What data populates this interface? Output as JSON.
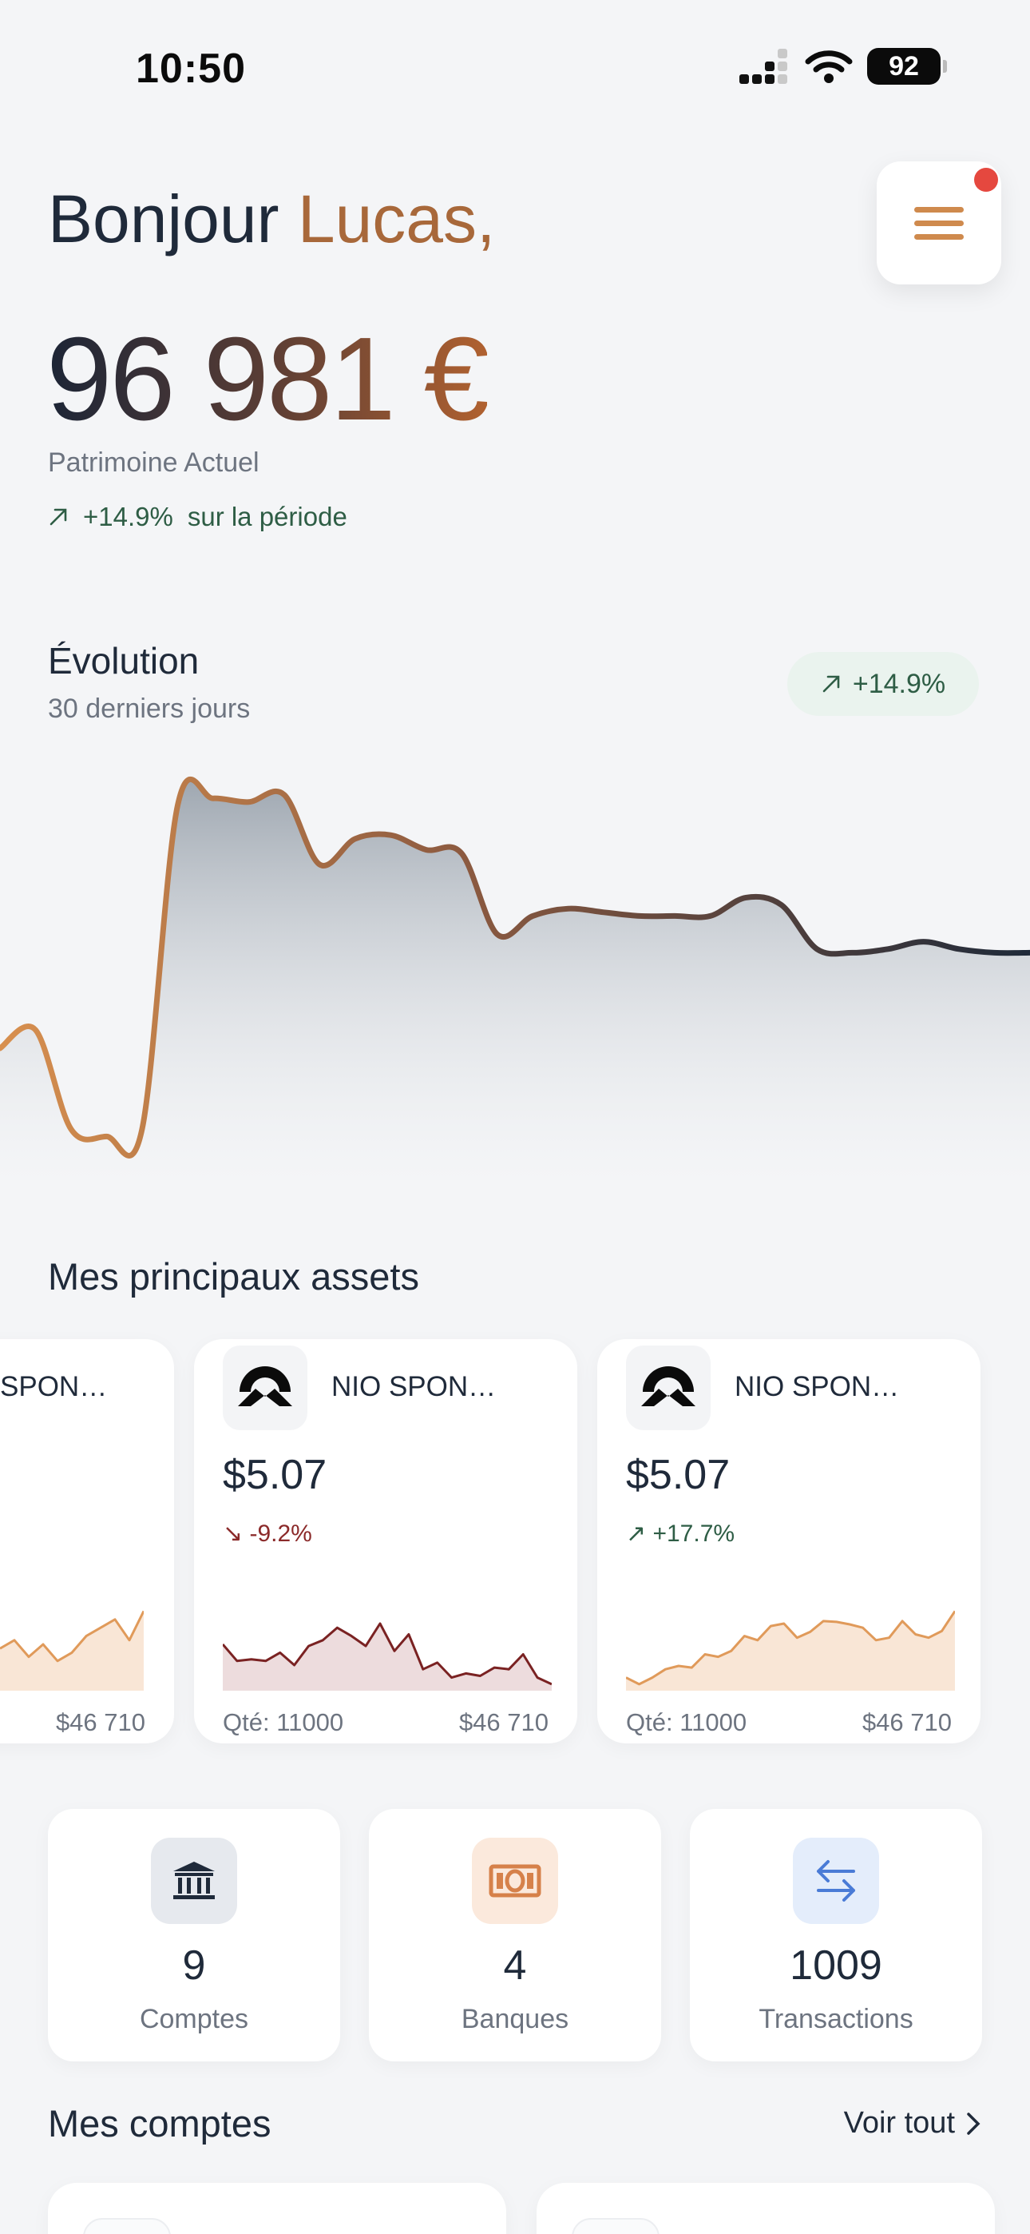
{
  "status": {
    "time": "10:50",
    "battery": "92"
  },
  "header": {
    "greeting": "Bonjour",
    "name": "Lucas,",
    "menu_has_notification": true
  },
  "balance": {
    "amount": "96 981 €",
    "label": "Patrimoine Actuel",
    "change": "+14.9%",
    "change_suffix": "sur la période"
  },
  "evolution": {
    "title": "Évolution",
    "subtitle": "30 derniers jours",
    "badge": "+14.9%"
  },
  "chart_data": {
    "type": "area",
    "title": "Évolution",
    "subtitle": "30 derniers jours",
    "xlabel": "",
    "ylabel": "",
    "series": [
      {
        "values": [
          0.3,
          0.35,
          0.08,
          0.06,
          0.08,
          0.96,
          0.98,
          0.97,
          0.99,
          0.8,
          0.87,
          0.88,
          0.84,
          0.83,
          0.61,
          0.66,
          0.68,
          0.67,
          0.66,
          0.66,
          0.66,
          0.71,
          0.69,
          0.57,
          0.56,
          0.57,
          0.59,
          0.57,
          0.56,
          0.56
        ]
      }
    ],
    "grid": false,
    "colors": [
      "#d18b4f",
      "#1f2a3a"
    ]
  },
  "assets": {
    "title": "Mes principaux assets",
    "cards": [
      {
        "name": "SPON…",
        "price": "",
        "change": "",
        "qty": "",
        "value": "$46 710",
        "trend": "up",
        "spark": [
          0.45,
          0.55,
          0.35,
          0.5,
          0.3,
          0.4,
          0.6,
          0.7,
          0.8,
          0.55,
          0.9
        ]
      },
      {
        "name": "NIO SPON…",
        "price": "$5.07",
        "change": "↘ -9.2%",
        "qty": "Qté: 11000",
        "value": "$46 710",
        "trend": "down",
        "spark": [
          0.5,
          0.3,
          0.32,
          0.3,
          0.4,
          0.25,
          0.48,
          0.55,
          0.7,
          0.6,
          0.48,
          0.75,
          0.42,
          0.62,
          0.2,
          0.28,
          0.1,
          0.15,
          0.12,
          0.22,
          0.2,
          0.38,
          0.1,
          0.02
        ]
      },
      {
        "name": "NIO SPON…",
        "price": "$5.07",
        "change": "↗ +17.7%",
        "qty": "Qté: 11000",
        "value": "$46 710",
        "trend": "up",
        "spark": [
          0.1,
          0.02,
          0.1,
          0.2,
          0.24,
          0.22,
          0.38,
          0.35,
          0.42,
          0.6,
          0.55,
          0.72,
          0.75,
          0.58,
          0.65,
          0.78,
          0.77,
          0.74,
          0.7,
          0.55,
          0.58,
          0.78,
          0.62,
          0.58,
          0.66,
          0.9
        ]
      }
    ]
  },
  "stats": [
    {
      "value": "9",
      "label": "Comptes",
      "icon": "bank-icon",
      "bg": "#e6e9ee",
      "fg": "#1f2a3a"
    },
    {
      "value": "4",
      "label": "Banques",
      "icon": "banknote-icon",
      "bg": "#fbe9dc",
      "fg": "#d6814a"
    },
    {
      "value": "1009",
      "label": "Transactions",
      "icon": "transfer-icon",
      "bg": "#e4edfb",
      "fg": "#4a7bd6"
    }
  ],
  "accounts": {
    "title": "Mes comptes",
    "see_all": "Voir tout"
  },
  "colors": {
    "accent": "#cf8a4d",
    "positive": "#2e5d45",
    "negative": "#8b2a2a"
  }
}
